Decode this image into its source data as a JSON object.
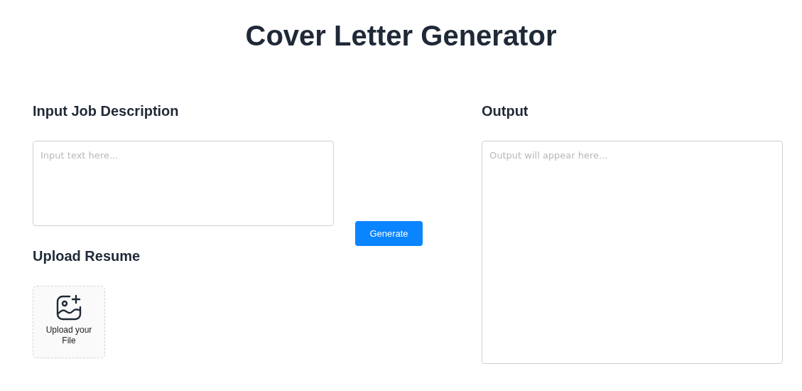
{
  "title": "Cover Letter Generator",
  "input_section": {
    "heading": "Input Job Description",
    "placeholder": "Input text here..."
  },
  "upload_section": {
    "heading": "Upload Resume",
    "label": "Upload your File"
  },
  "generate_button": "Generate",
  "output_section": {
    "heading": "Output",
    "placeholder": "Output will appear here..."
  }
}
